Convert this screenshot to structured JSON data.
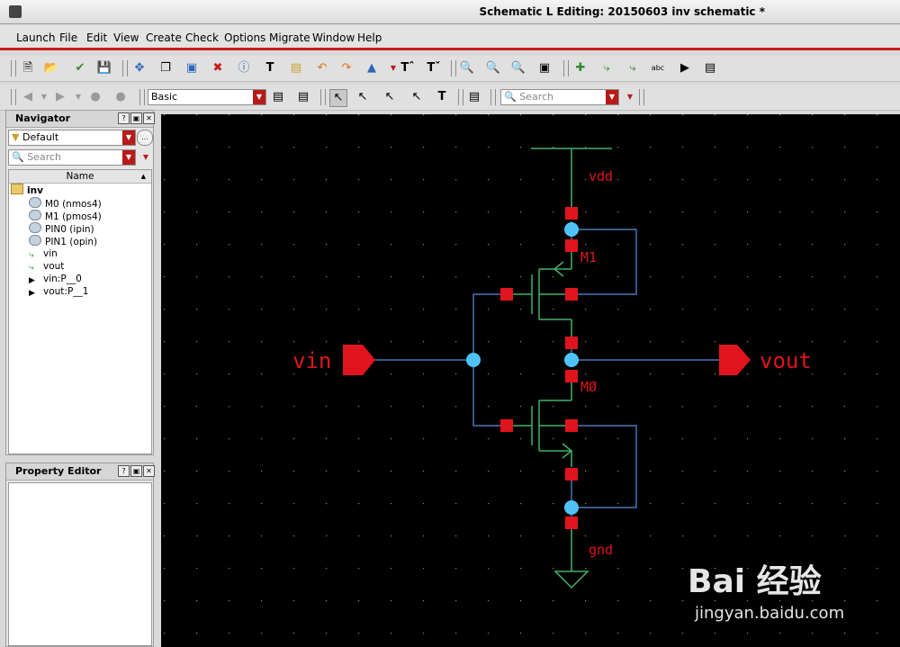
{
  "window": {
    "title": "Schematic L Editing: 20150603 inv schematic *"
  },
  "menu": [
    "Launch",
    "File",
    "Edit",
    "View",
    "Create",
    "Check",
    "Options",
    "Migrate",
    "Window",
    "Help"
  ],
  "toolbar2": {
    "view_combo": "Basic",
    "search_placeholder": "Search"
  },
  "navigator": {
    "title": "Navigator",
    "filter": "Default",
    "search_placeholder": "Search",
    "column": "Name",
    "root": "inv",
    "items": [
      "M0 (nmos4)",
      "M1 (pmos4)",
      "PIN0 (ipin)",
      "PIN1 (opin)",
      "vin",
      "vout",
      "vin:P__0",
      "vout:P__1"
    ]
  },
  "property_editor": {
    "title": "Property Editor"
  },
  "schematic": {
    "labels": {
      "vdd": "vdd",
      "gnd": "gnd",
      "m1": "M1",
      "m0": "MØ",
      "vin": "vin",
      "vout": "vout"
    },
    "colors": {
      "wire": "#5a8fd9",
      "net_green": "#3fb36a",
      "pin": "#e0141e",
      "dot": "#4fc3f7",
      "label": "#e0141e",
      "background": "#000000"
    }
  },
  "watermark": {
    "brand": "Bai 经验",
    "url": "jingyan.baidu.com"
  }
}
